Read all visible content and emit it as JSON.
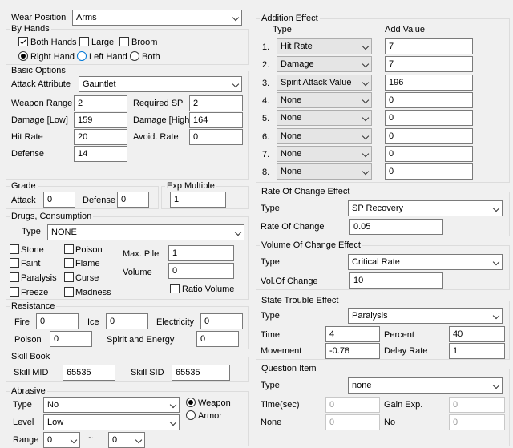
{
  "wear_position": {
    "label": "Wear Position",
    "value": "Arms"
  },
  "by_hands": {
    "title": "By Hands",
    "both_hands": "Both Hands",
    "large": "Large",
    "broom": "Broom",
    "right_hand": "Right Hand",
    "left_hand": "Left Hand",
    "both": "Both",
    "both_hands_checked": true,
    "large_checked": false,
    "broom_checked": false,
    "hand_selected": "Right Hand"
  },
  "basic_options": {
    "title": "Basic Options",
    "attack_attribute_label": "Attack Attribute",
    "attack_attribute": "Gauntlet",
    "weapon_range_label": "Weapon Range",
    "weapon_range": "2",
    "required_sp_label": "Required SP",
    "required_sp": "2",
    "damage_low_label": "Damage [Low]",
    "damage_low": "159",
    "damage_high_label": "Damage [High]",
    "damage_high": "164",
    "hit_rate_label": "Hit Rate",
    "hit_rate": "20",
    "avoid_rate_label": "Avoid. Rate",
    "avoid_rate": "0",
    "defense_label": "Defense",
    "defense": "14"
  },
  "grade": {
    "title": "Grade",
    "attack_label": "Attack",
    "attack": "0",
    "defense_label": "Defense",
    "defense": "0"
  },
  "exp_multiple": {
    "title": "Exp Multiple",
    "value": "1"
  },
  "drugs": {
    "title": "Drugs, Consumption",
    "type_label": "Type",
    "type": "NONE",
    "stone": "Stone",
    "poison": "Poison",
    "faint": "Faint",
    "flame": "Flame",
    "paralysis": "Paralysis",
    "curse": "Curse",
    "freeze": "Freeze",
    "madness": "Madness",
    "max_pile_label": "Max. Pile",
    "max_pile": "1",
    "volume_label": "Volume",
    "volume": "0",
    "ratio_volume": "Ratio Volume"
  },
  "resistance": {
    "title": "Resistance",
    "fire_label": "Fire",
    "fire": "0",
    "ice_label": "Ice",
    "ice": "0",
    "electricity_label": "Electricity",
    "electricity": "0",
    "poison_label": "Poison",
    "poison": "0",
    "spirit_label": "Spirit and Energy",
    "spirit": "0"
  },
  "skill_book": {
    "title": "Skill Book",
    "mid_label": "Skill MID",
    "mid": "65535",
    "sid_label": "Skill SID",
    "sid": "65535"
  },
  "abrasive": {
    "title": "Abrasive",
    "type_label": "Type",
    "type": "No",
    "level_label": "Level",
    "level": "Low",
    "range_label": "Range",
    "range_from": "0",
    "range_sep": "~",
    "range_to": "0",
    "weapon": "Weapon",
    "armor": "Armor",
    "selected": "Weapon"
  },
  "addition_effect": {
    "title": "Addition Effect",
    "type_header": "Type",
    "value_header": "Add Value",
    "rows": [
      {
        "n": "1.",
        "type": "Hit Rate",
        "value": "7"
      },
      {
        "n": "2.",
        "type": "Damage",
        "value": "7"
      },
      {
        "n": "3.",
        "type": "Spirit Attack Value",
        "value": "196"
      },
      {
        "n": "4.",
        "type": "None",
        "value": "0"
      },
      {
        "n": "5.",
        "type": "None",
        "value": "0"
      },
      {
        "n": "6.",
        "type": "None",
        "value": "0"
      },
      {
        "n": "7.",
        "type": "None",
        "value": "0"
      },
      {
        "n": "8.",
        "type": "None",
        "value": "0"
      }
    ]
  },
  "rate_change": {
    "title": "Rate Of Change Effect",
    "type_label": "Type",
    "type": "SP Recovery",
    "rate_label": "Rate Of Change",
    "rate": "0.05"
  },
  "volume_change": {
    "title": "Volume Of Change Effect",
    "type_label": "Type",
    "type": "Critical Rate",
    "vol_label": "Vol.Of Change",
    "vol": "10"
  },
  "state_trouble": {
    "title": "State Trouble Effect",
    "type_label": "Type",
    "type": "Paralysis",
    "time_label": "Time",
    "time": "4",
    "percent_label": "Percent",
    "percent": "40",
    "movement_label": "Movement",
    "movement": "-0.78",
    "delay_label": "Delay Rate",
    "delay": "1"
  },
  "question_item": {
    "title": "Question Item",
    "type_label": "Type",
    "type": "none",
    "time_label": "Time(sec)",
    "time": "0",
    "gain_label": "Gain Exp.",
    "gain": "0",
    "none_label": "None",
    "none": "0",
    "no_label": "No",
    "no": "0"
  }
}
